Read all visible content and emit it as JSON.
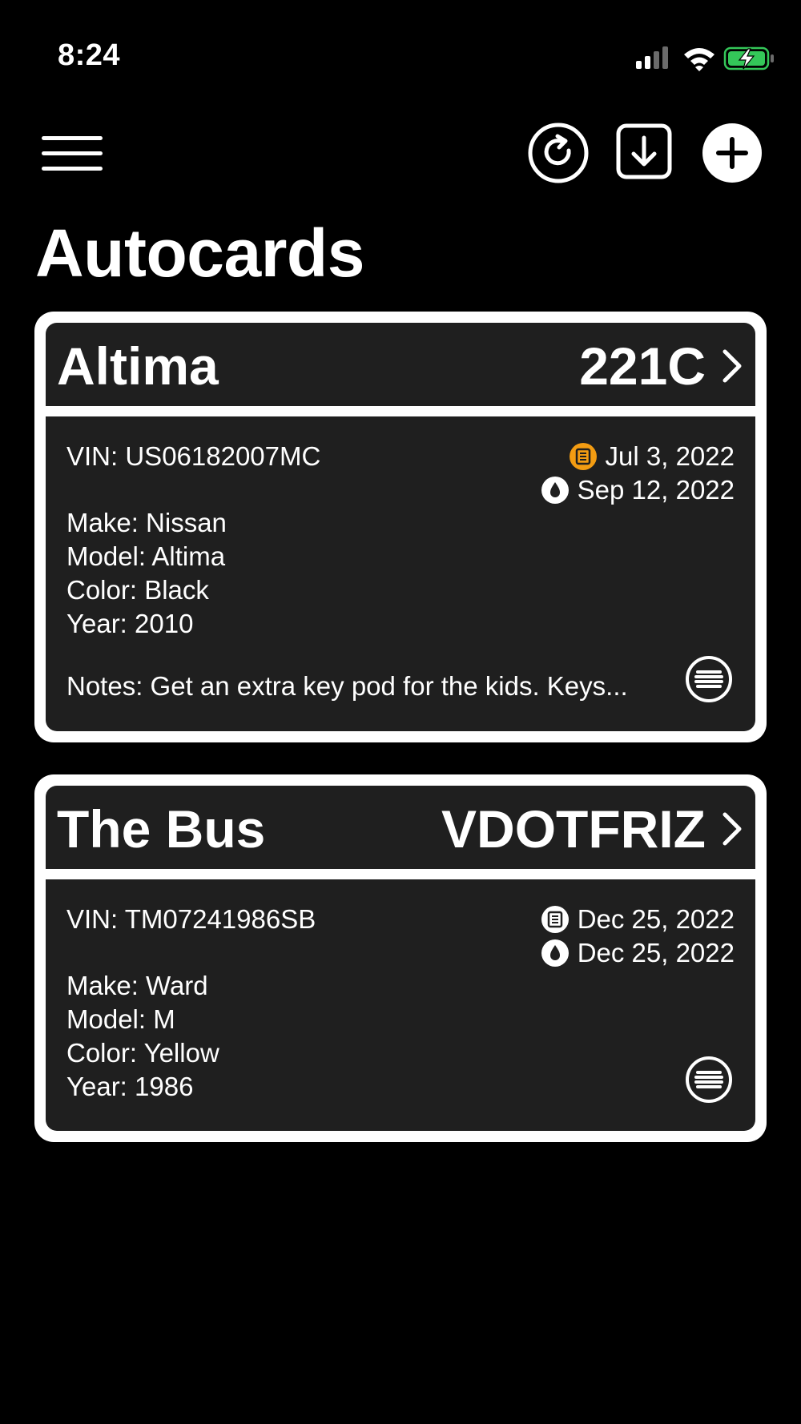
{
  "status_bar": {
    "time": "8:24"
  },
  "toolbar": {
    "menu_icon": "hamburger-menu-icon",
    "refresh_icon": "refresh-circle-icon",
    "download_icon": "download-square-icon",
    "add_icon": "plus-circle-icon"
  },
  "page": {
    "title": "Autocards"
  },
  "colors": {
    "background": "#000000",
    "card_border": "#ffffff",
    "card_fill": "#1f1f1f",
    "text": "#ffffff",
    "alert_orange": "#f39c12",
    "battery_green": "#34c759"
  },
  "cards": [
    {
      "name": "Altima",
      "plate": "221C",
      "vin": "VIN: US06182007MC",
      "make": "Make: Nissan",
      "model": "Model: Altima",
      "color": "Color: Black",
      "year": "Year: 2010",
      "notes": "Notes: Get an extra key pod for the kids. Keys...",
      "registration_date": "Jul 3, 2022",
      "registration_icon": "registration-document-icon",
      "registration_icon_color": "#f39c12",
      "oil_change_date": "Sep 12, 2022",
      "oil_icon": "oil-drop-icon",
      "menu_icon": "list-circle-icon"
    },
    {
      "name": "The Bus",
      "plate": "VDOTFRIZ",
      "vin": "VIN: TM07241986SB",
      "make": "Make: Ward",
      "model": "Model: M",
      "color": "Color: Yellow",
      "year": "Year: 1986",
      "notes": "",
      "registration_date": "Dec 25, 2022",
      "registration_icon": "registration-document-icon",
      "registration_icon_color": "#ffffff",
      "oil_change_date": "Dec 25, 2022",
      "oil_icon": "oil-drop-icon",
      "menu_icon": "list-circle-icon"
    }
  ]
}
